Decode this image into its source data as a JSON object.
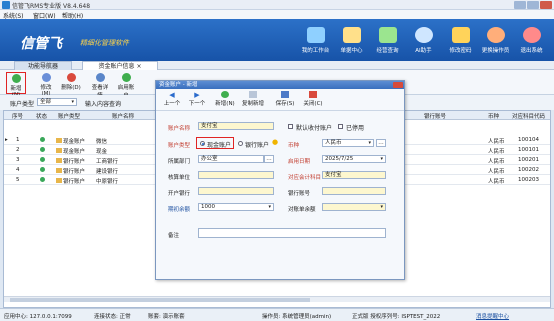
{
  "window": {
    "title": "信管飞RMS专业版 V8.4.648"
  },
  "menu": [
    "系统(S)",
    "窗口(W)",
    "帮助(H)"
  ],
  "banner": {
    "logo": "信管飞",
    "slogan": "精细化管理软件",
    "buttons": [
      {
        "label": "我的工作台",
        "icon": "desktop-icon",
        "color": "#8fd0ff"
      },
      {
        "label": "单据中心",
        "icon": "documents-icon",
        "color": "#ffe08a"
      },
      {
        "label": "经营查询",
        "icon": "chart-icon",
        "color": "#9be58f"
      },
      {
        "label": "AI助手",
        "icon": "info-icon",
        "color": "#cfe6ff"
      },
      {
        "label": "修改密码",
        "icon": "lock-icon",
        "color": "#ffd35a"
      },
      {
        "label": "更换操作员",
        "icon": "user-icon",
        "color": "#ffae7a"
      },
      {
        "label": "退出系统",
        "icon": "power-icon",
        "color": "#ff8a8a"
      }
    ]
  },
  "tabs": [
    {
      "label": "功能导航器"
    },
    {
      "label": "资金账户信息",
      "close": "×"
    }
  ],
  "toolbar": [
    {
      "label": "新增(N)",
      "icon": "add-icon",
      "color": "#3fae4e"
    },
    {
      "label": "修改(M)",
      "icon": "edit-icon",
      "color": "#6a8fd8"
    },
    {
      "label": "删除(D)",
      "icon": "delete-icon",
      "color": "#d94a3d"
    },
    {
      "label": "查看详情",
      "icon": "detail-icon",
      "color": "#5a86c9"
    },
    {
      "label": "启用账户",
      "icon": "enable-icon",
      "color": "#3fae4e"
    }
  ],
  "filter": {
    "type_label": "账户类型",
    "type_value": "全部",
    "search_label": "输入内容查询"
  },
  "grid": {
    "headers": [
      "序号",
      "状态",
      "账户类型",
      "账户名称",
      "银行账号",
      "币种",
      "对应科目代码"
    ],
    "rows": [
      {
        "no": "1",
        "type": "现金账户",
        "name": "微信",
        "currency": "人民币",
        "code": "100104"
      },
      {
        "no": "2",
        "type": "现金账户",
        "name": "现金",
        "currency": "人民币",
        "code": "100101"
      },
      {
        "no": "3",
        "type": "银行账户",
        "name": "工商银行",
        "currency": "人民币",
        "code": "100201"
      },
      {
        "no": "4",
        "type": "银行账户",
        "name": "建设银行",
        "currency": "人民币",
        "code": "100202"
      },
      {
        "no": "5",
        "type": "银行账户",
        "name": "中原银行",
        "currency": "人民币",
        "code": "100203"
      }
    ]
  },
  "dialog": {
    "title": "资金账户 - 新增",
    "toolbar": [
      {
        "label": "上一个",
        "icon": "prev-icon"
      },
      {
        "label": "下一个",
        "icon": "next-icon"
      },
      {
        "label": "新增(N)",
        "icon": "add-icon"
      },
      {
        "label": "复制新增",
        "icon": "copy-icon"
      },
      {
        "label": "保存(S)",
        "icon": "save-icon"
      },
      {
        "label": "关闭(C)",
        "icon": "close-icon"
      }
    ],
    "fields": {
      "name_label": "账户名称",
      "name_value": "支付宝",
      "default_label": "默认收付账户",
      "disabled_label": "已停用",
      "type_label": "账户类型",
      "type_cash": "现金账户",
      "type_bank": "银行账户",
      "currency_label": "币种",
      "currency_value": "人民币",
      "dept_label": "所属部门",
      "dept_value": "办公室",
      "date_label": "启用日期",
      "date_value": "2025/7/25",
      "unit_label": "核算单位",
      "subject_label": "对应会计科目",
      "subject_value": "支付宝",
      "bank_label": "开户银行",
      "account_label": "银行账号",
      "balance_label": "期初余额",
      "balance_value": "1000",
      "settle_label": "对账单余额",
      "note_label": "备注"
    }
  },
  "status": {
    "center": "应用中心: 127.0.0.1:7099",
    "conn": "连接状态: 正常",
    "account": "账套: 演示账套",
    "operator": "操作员: 系统管理员(admin)",
    "version": "正式版 授权序列号: ISPTEST_2022",
    "msg": "消息提醒中心"
  }
}
